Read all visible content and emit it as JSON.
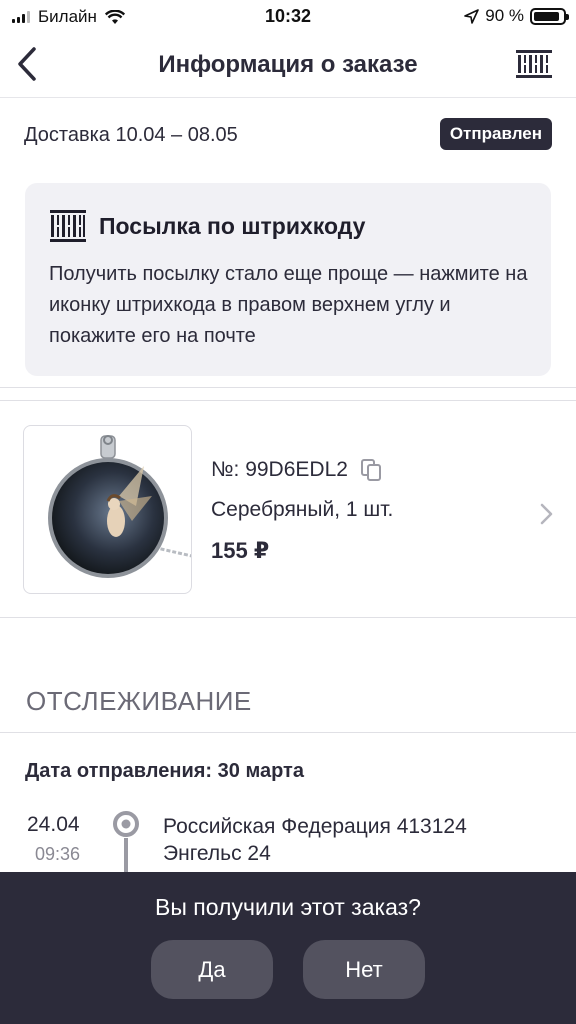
{
  "status_bar": {
    "carrier": "Билайн",
    "time": "10:32",
    "battery": "90 %",
    "battery_level": 0.9
  },
  "nav": {
    "title": "Информация о заказе",
    "back_icon": "chevron-left-icon",
    "barcode_icon": "barcode-icon"
  },
  "delivery": {
    "range": "Доставка 10.04 – 08.05",
    "status": "Отправлен"
  },
  "info_card": {
    "title": "Посылка по штрихкоду",
    "text": "Получить посылку стало еще проще — нажмите на иконку штрихкода в правом верхнем углу и покажите его на почте"
  },
  "product": {
    "number": "№: 99D6EDL2",
    "variant": "Серебряный, 1 шт.",
    "price": "155 ₽"
  },
  "tracking": {
    "title": "ОТСЛЕЖИВАНИЕ",
    "ship_date": "Дата отправления: 30 марта",
    "events": [
      {
        "date": "24.04",
        "time": "09:36",
        "place_line1": "Российская Федерация 413124",
        "place_line2": "Энгельс 24"
      }
    ]
  },
  "bottom_sheet": {
    "question": "Вы получили этот заказ?",
    "yes": "Да",
    "no": "Нет"
  },
  "colors": {
    "primary_dark": "#2c2b3a",
    "card_bg": "#f1f1f5",
    "button_bg": "#53525f"
  }
}
